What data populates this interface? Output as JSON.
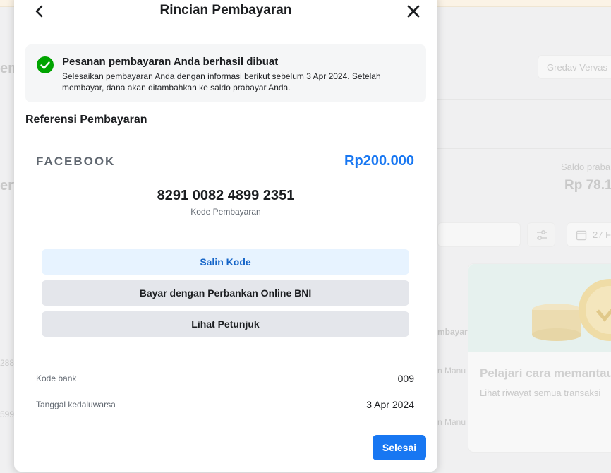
{
  "modal": {
    "title": "Rincian Pembayaran",
    "notice": {
      "title": "Pesanan pembayaran Anda berhasil dibuat",
      "body": "Selesaikan pembayaran Anda dengan informasi berikut sebelum 3 Apr 2024. Setelah membayar, dana akan ditambahkan ke saldo prabayar Anda."
    },
    "section_title": "Referensi Pembayaran",
    "merchant": "FACEBOOK",
    "amount": "Rp200.000",
    "payment_code": "8291 0082 4899 2351",
    "payment_code_label": "Kode Pembayaran",
    "buttons": {
      "copy_code": "Salin Kode",
      "pay_online": "Bayar dengan Perbankan Online BNI",
      "view_guide": "Lihat Petunjuk"
    },
    "details": [
      {
        "label": "Kode bank",
        "value": "009"
      },
      {
        "label": "Tanggal kedaluwarsa",
        "value": "3 Apr 2024"
      }
    ],
    "done_label": "Selesai"
  },
  "background": {
    "account_text": "Gredav Vervas",
    "balance_label": "Saldo praba",
    "balance_value": "Rp 78.1",
    "date_fragment": "27 F",
    "col_fragment": "mbayar",
    "row_fragment_1": "n Manu",
    "row_fragment_2": "n Manu",
    "promo_title": "Pelajari cara memantau",
    "promo_sub": "Lihat riwayat semua transaksi",
    "left_frag_1": "em",
    "left_frag_2": "erv",
    "left_frag_3": "288",
    "left_frag_4": "599"
  },
  "colors": {
    "accent": "#1877f2",
    "success": "#00a400",
    "secondary_button": "#e4e6eb",
    "copy_button": "#e7f3ff"
  },
  "icons": {
    "back": "chevron-left-icon",
    "close": "close-icon",
    "check": "check-circle-icon"
  }
}
